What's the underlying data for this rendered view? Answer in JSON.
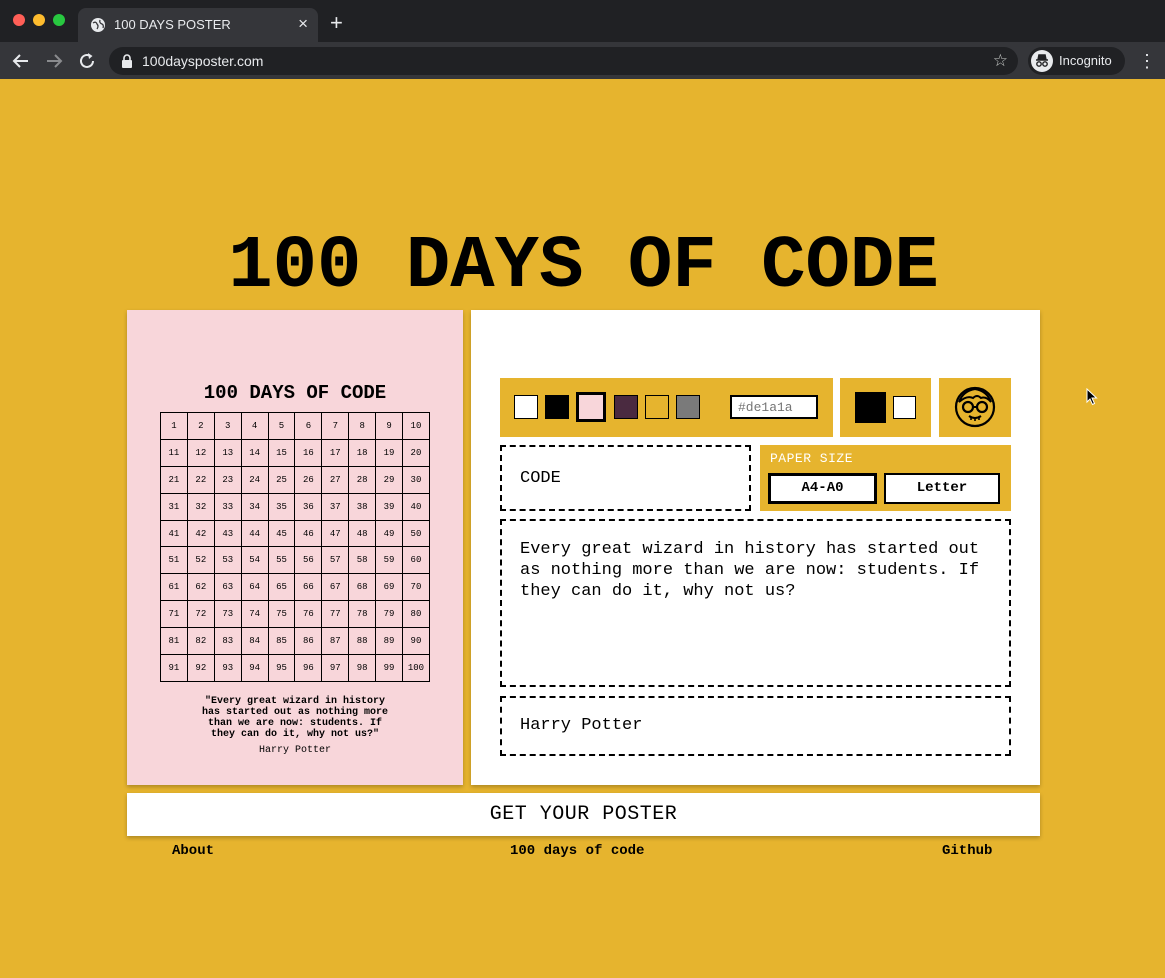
{
  "browser": {
    "tab_title": "100 DAYS POSTER",
    "tab_close": "×",
    "new_tab": "+",
    "url": "100daysposter.com",
    "star": "☆",
    "incognito_label": "Incognito",
    "menu": "⋮"
  },
  "page": {
    "title": "100 DAYS OF CODE"
  },
  "poster": {
    "title": "100 DAYS OF CODE",
    "day_rows": [
      [
        "1",
        "2",
        "3",
        "4",
        "5",
        "6",
        "7",
        "8",
        "9",
        "10"
      ],
      [
        "11",
        "12",
        "13",
        "14",
        "15",
        "16",
        "17",
        "18",
        "19",
        "20"
      ],
      [
        "21",
        "22",
        "23",
        "24",
        "25",
        "26",
        "27",
        "28",
        "29",
        "30"
      ],
      [
        "31",
        "32",
        "33",
        "34",
        "35",
        "36",
        "37",
        "38",
        "39",
        "40"
      ],
      [
        "41",
        "42",
        "43",
        "44",
        "45",
        "46",
        "47",
        "48",
        "49",
        "50"
      ],
      [
        "51",
        "52",
        "53",
        "54",
        "55",
        "56",
        "57",
        "58",
        "59",
        "60"
      ],
      [
        "61",
        "62",
        "63",
        "64",
        "65",
        "66",
        "67",
        "68",
        "69",
        "70"
      ],
      [
        "71",
        "72",
        "73",
        "74",
        "75",
        "76",
        "77",
        "78",
        "79",
        "80"
      ],
      [
        "81",
        "82",
        "83",
        "84",
        "85",
        "86",
        "87",
        "88",
        "89",
        "90"
      ],
      [
        "91",
        "92",
        "93",
        "94",
        "95",
        "96",
        "97",
        "98",
        "99",
        "100"
      ]
    ],
    "quote": "\"Every great wizard in history has started out as nothing more than we are now: students. If they can do it, why not us?\"",
    "author": "Harry Potter"
  },
  "editor": {
    "swatches": [
      {
        "color": "#ffffff",
        "selected": false
      },
      {
        "color": "#000000",
        "selected": false
      },
      {
        "color": "#f8d6da",
        "selected": true
      },
      {
        "color": "#4a2a40",
        "selected": false
      },
      {
        "color": "#e6b42e",
        "selected": false
      },
      {
        "color": "#7a7a7a",
        "selected": false
      }
    ],
    "hex_placeholder": "#de1a1a",
    "code_value": "CODE",
    "paper_size_label": "PAPER SIZE",
    "paper_sizes": [
      "A4-A0",
      "Letter"
    ],
    "selected_paper_size": "A4-A0",
    "quote_value": "Every great wizard in history has started out as nothing more than we are now: students. If they can do it, why not us?",
    "author_value": "Harry Potter"
  },
  "cta": {
    "label": "GET YOUR POSTER"
  },
  "footer": {
    "about": "About",
    "center": "100 days of code",
    "github": "Github"
  },
  "colors": {
    "page_background": "#e6b42e",
    "poster_background": "#f8d6da"
  }
}
